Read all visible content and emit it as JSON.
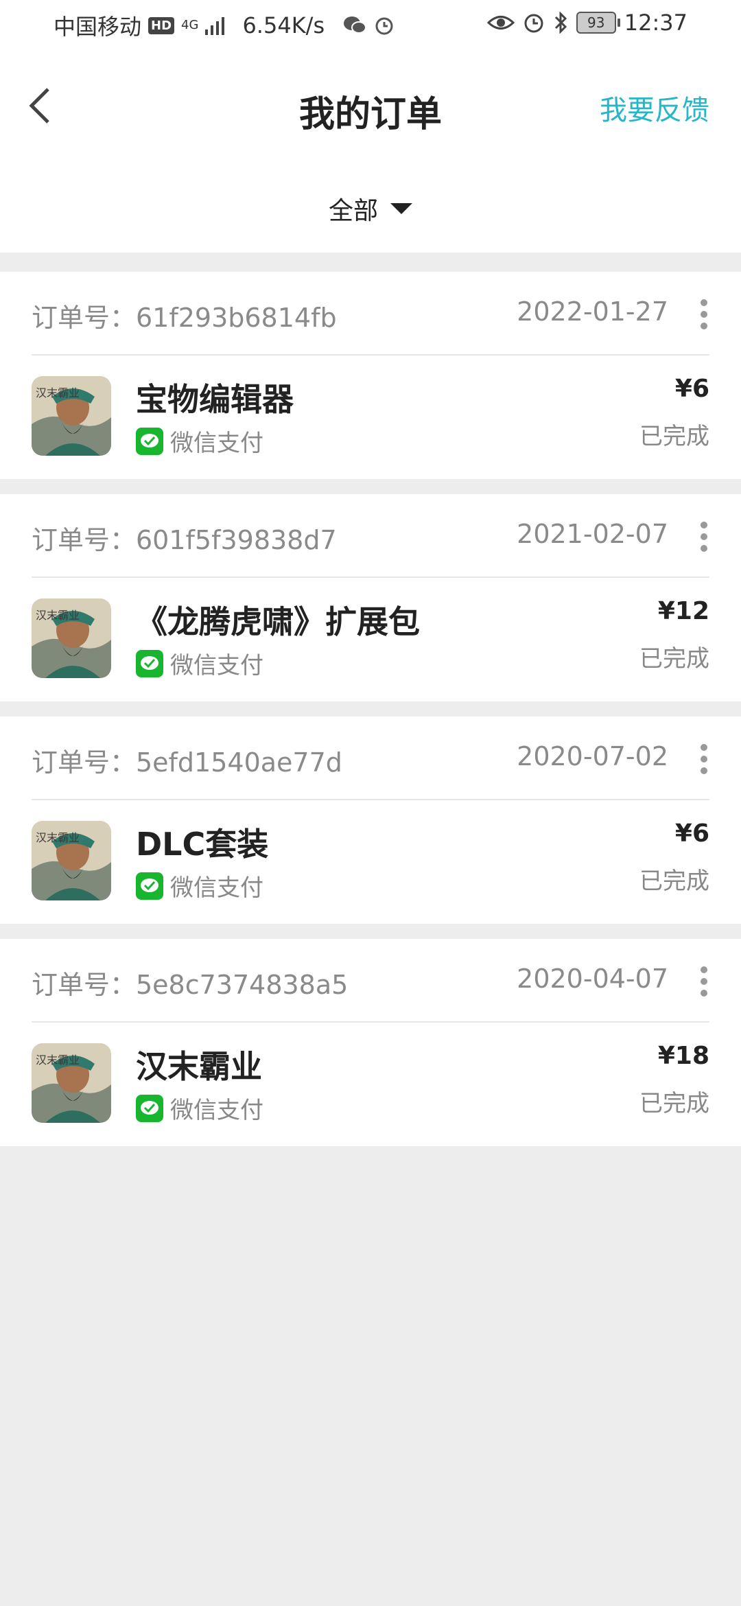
{
  "statusbar": {
    "carrier": "中国移动",
    "hd": "HD",
    "net": "4G",
    "speed": "6.54K/s",
    "battery": "93",
    "time": "12:37"
  },
  "header": {
    "title": "我的订单",
    "feedback": "我要反馈"
  },
  "filter": {
    "label": "全部"
  },
  "colors": {
    "accent": "#25b6c8",
    "wechat": "#18b62f",
    "background": "#ededed"
  },
  "orders": [
    {
      "id_label": "订单号：61f293b6814fb",
      "date": "2022-01-27",
      "name": "宝物编辑器",
      "pay": "微信支付",
      "price": "¥6",
      "status": "已完成"
    },
    {
      "id_label": "订单号：601f5f39838d7",
      "date": "2021-02-07",
      "name": "《龙腾虎啸》扩展包",
      "pay": "微信支付",
      "price": "¥12",
      "status": "已完成"
    },
    {
      "id_label": "订单号：5efd1540ae77d",
      "date": "2020-07-02",
      "name": "DLC套装",
      "pay": "微信支付",
      "price": "¥6",
      "status": "已完成"
    },
    {
      "id_label": "订单号：5e8c7374838a5",
      "date": "2020-04-07",
      "name": "汉末霸业",
      "pay": "微信支付",
      "price": "¥18",
      "status": "已完成"
    }
  ]
}
